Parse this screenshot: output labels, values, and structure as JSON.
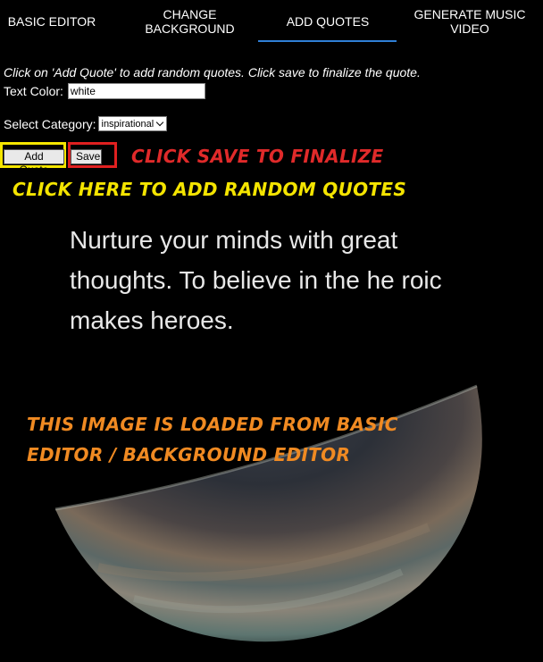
{
  "tabs": [
    {
      "label": "BASIC EDITOR",
      "active": false
    },
    {
      "label": "CHANGE BACKGROUND",
      "active": false
    },
    {
      "label": "ADD QUOTES",
      "active": true
    },
    {
      "label": "GENERATE MUSIC VIDEO",
      "active": false
    }
  ],
  "instructions": "Click on 'Add Quote' to add random quotes. Click save to finalize the quote.",
  "text_color": {
    "label": "Text Color:",
    "value": "white"
  },
  "category": {
    "label": "Select Category:",
    "selected": "inspirational"
  },
  "buttons": {
    "add_quote": "Add Quote",
    "save": "Save"
  },
  "annotations": {
    "save_hint": "CLICK SAVE TO FINALIZE",
    "add_hint": "CLICK HERE TO ADD RANDOM QUOTES",
    "image_hint": "THIS IMAGE IS LOADED FROM BASIC EDITOR / BACKGROUND EDITOR"
  },
  "quote_text": "Nurture your minds with great thoughts. To believe in the he roic makes heroes.",
  "colors": {
    "background": "#000000",
    "tab_indicator": "#2f7fd6",
    "highlight_add": "#f5e600",
    "highlight_save": "#e02020",
    "annotation_save": "#e02a2a",
    "annotation_add": "#f4e400",
    "annotation_image": "#f08a22"
  }
}
